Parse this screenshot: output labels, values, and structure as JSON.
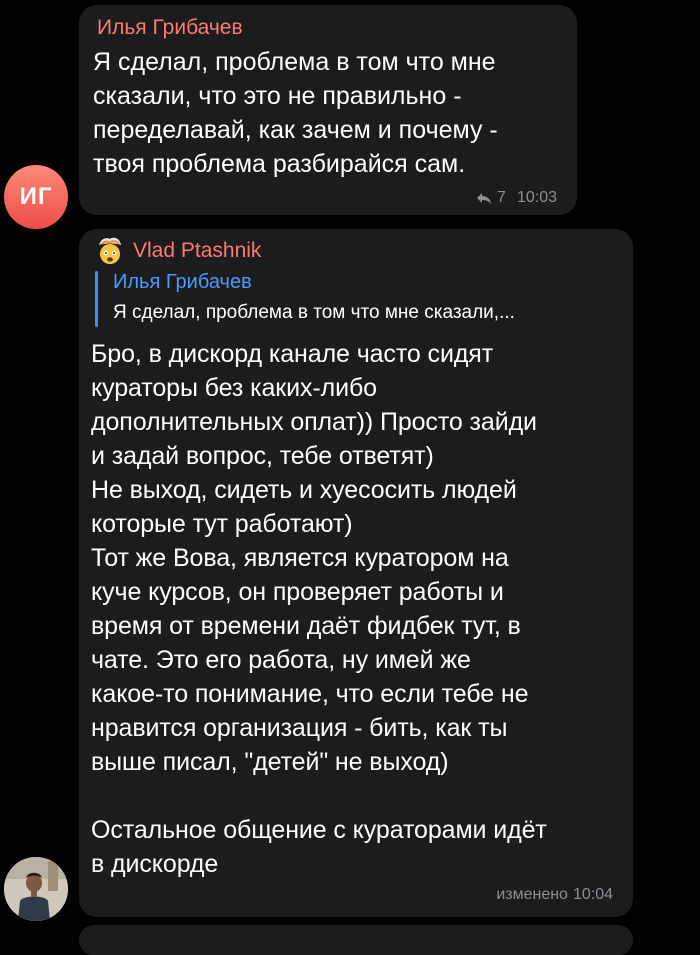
{
  "messages": [
    {
      "sender": "Илья Грибачев",
      "avatar_initials": "ИГ",
      "text": "Я сделал, проблема в том что мне\nсказали, что это не правильно -\nпеределавай, как зачем и почему -\nтвоя проблема разбирайся сам.",
      "reply_count": "7",
      "time": "10:03",
      "icons": [
        "reply-arrow-icon"
      ]
    },
    {
      "sender": "Vlad Ptashnik",
      "sender_emoji": "exploding-head-emoji",
      "reply_to": {
        "name": "Илья Грибачев",
        "text": "Я сделал, проблема в том что мне сказали,..."
      },
      "text": "Бро, в дискорд канале часто сидят\nкураторы без каких-либо\nдополнительных оплат)) Просто зайди\nи задай вопрос, тебе ответят)\nНе выход, сидеть и хуесосить людей\nкоторые тут работают)\nТот же Вова, является куратором на\nкуче курсов, он проверяет работы и\nвремя от времени даёт фидбек тут, в\nчате. Это его работа, ну имей же\nкакое-то понимание, что если тебе не\nнравится организация - бить, как ты\nвыше писал, \"детей\" не выход)\n\nОстальное общение с кураторами идёт\nв дискорде",
      "edited_label": "изменено",
      "time": "10:04"
    }
  ],
  "colors": {
    "background": "#000000",
    "bubble": "#1c1c1e",
    "sender_name": "#fd7a6e",
    "reply_accent": "#3d8dff",
    "meta": "#8e8e93"
  }
}
